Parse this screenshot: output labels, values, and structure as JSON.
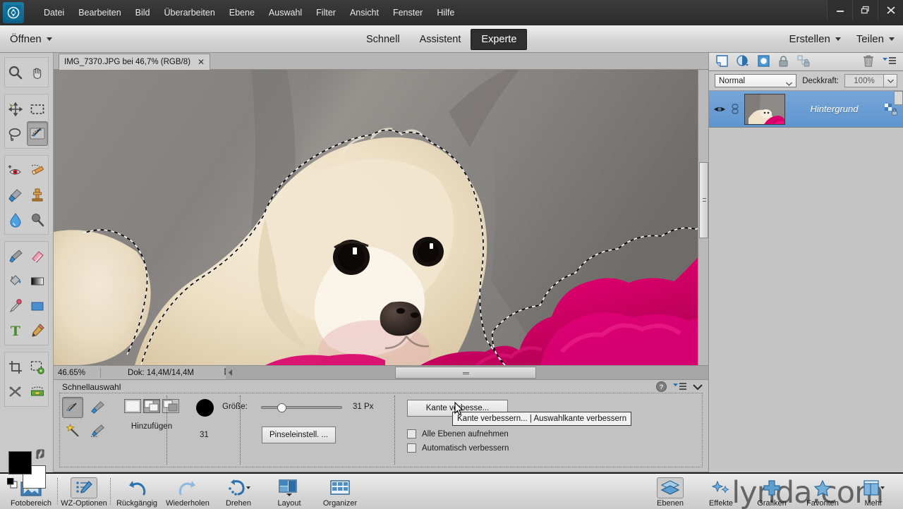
{
  "window": {
    "app_icon": "photoshop-elements-logo",
    "controls": {
      "minimize": "minimize-icon",
      "restore": "restore-icon",
      "close": "close-icon"
    }
  },
  "menubar": {
    "items": [
      {
        "label": "Datei"
      },
      {
        "label": "Bearbeiten"
      },
      {
        "label": "Bild"
      },
      {
        "label": "Überarbeiten"
      },
      {
        "label": "Ebene"
      },
      {
        "label": "Auswahl"
      },
      {
        "label": "Filter"
      },
      {
        "label": "Ansicht"
      },
      {
        "label": "Fenster"
      },
      {
        "label": "Hilfe"
      }
    ]
  },
  "modebar": {
    "open_label": "Öffnen",
    "modes": [
      {
        "label": "Schnell",
        "active": false
      },
      {
        "label": "Assistent",
        "active": false
      },
      {
        "label": "Experte",
        "active": true
      }
    ],
    "actions": [
      {
        "label": "Erstellen"
      },
      {
        "label": "Teilen"
      }
    ]
  },
  "toolbar": {
    "groups": [
      {
        "tools": [
          {
            "name": "zoom-tool"
          },
          {
            "name": "hand-tool"
          }
        ]
      },
      {
        "tools": [
          {
            "name": "move-tool"
          },
          {
            "name": "rectangular-marquee-tool"
          },
          {
            "name": "lasso-tool"
          },
          {
            "name": "quick-selection-tool",
            "selected": true
          }
        ]
      },
      {
        "tools": [
          {
            "name": "red-eye-removal-tool"
          },
          {
            "name": "spot-healing-brush-tool"
          },
          {
            "name": "smart-brush-tool"
          },
          {
            "name": "clone-stamp-tool"
          },
          {
            "name": "blur-tool"
          },
          {
            "name": "sponge-tool"
          }
        ]
      },
      {
        "tools": [
          {
            "name": "brush-tool"
          },
          {
            "name": "eraser-tool"
          },
          {
            "name": "paint-bucket-tool"
          },
          {
            "name": "gradient-tool"
          },
          {
            "name": "eyedropper-tool"
          },
          {
            "name": "shape-tool"
          },
          {
            "name": "type-tool"
          },
          {
            "name": "pencil-tool"
          }
        ]
      },
      {
        "tools": [
          {
            "name": "crop-tool"
          },
          {
            "name": "recompose-tool"
          },
          {
            "name": "content-aware-move-tool"
          },
          {
            "name": "straighten-tool"
          }
        ]
      }
    ],
    "colors": {
      "foreground": "#000000",
      "background": "#ffffff"
    }
  },
  "document": {
    "tab_title": "IMG_7370.JPG bei 46,7% (RGB/8)",
    "close_icon": "close-icon"
  },
  "statusbar": {
    "zoom": "46.65%",
    "doc_size": "Dok: 14,4M/14,4M"
  },
  "options": {
    "title": "Schnellauswahl",
    "header_icons": [
      "help-icon",
      "panel-menu-icon",
      "collapse-chevron-icon"
    ],
    "mode_tools": [
      {
        "name": "quick-selection-brush",
        "selected": true
      },
      {
        "name": "selection-brush"
      },
      {
        "name": "magic-wand"
      },
      {
        "name": "refine-selection-brush"
      }
    ],
    "add_label": "Hinzufügen",
    "add_modes": [
      {
        "name": "new-selection"
      },
      {
        "name": "add-to-selection",
        "selected": true
      },
      {
        "name": "subtract-from-selection"
      }
    ],
    "brush_preview_value": "31",
    "size_label": "Größe:",
    "size_value": "31 Px",
    "brush_settings_label": "Pinseleinstell. ...",
    "refine_edge_label": "Kante verbesse...",
    "checkboxes": [
      {
        "label": "Alle Ebenen aufnehmen",
        "checked": false
      },
      {
        "label": "Automatisch verbessern",
        "checked": false
      }
    ],
    "tooltip": "Kante verbessern... | Auswahlkante verbessern"
  },
  "layers_panel": {
    "toolbar_icons": [
      "new-layer-icon",
      "adjustment-layer-icon",
      "layer-mask-icon",
      "lock-icon",
      "link-layers-icon",
      "delete-layer-icon",
      "panel-menu-icon"
    ],
    "blend_mode": "Normal",
    "opacity_label": "Deckkraft:",
    "opacity_value": "100%",
    "layers": [
      {
        "name": "Hintergrund",
        "visible": true,
        "locked": true,
        "selected": true
      }
    ]
  },
  "taskbar": {
    "left_items": [
      {
        "label": "Fotobereich",
        "icon": "photo-bin-icon",
        "active": false
      },
      {
        "label": "WZ-Optionen",
        "icon": "tool-options-icon",
        "active": true
      },
      {
        "label": "Rückgängig",
        "icon": "undo-icon",
        "active": false
      },
      {
        "label": "Wiederholen",
        "icon": "redo-icon",
        "active": false
      },
      {
        "label": "Drehen",
        "icon": "rotate-icon",
        "active": false
      },
      {
        "label": "Layout",
        "icon": "layout-icon",
        "active": false
      },
      {
        "label": "Organizer",
        "icon": "organizer-icon",
        "active": false
      }
    ],
    "right_items": [
      {
        "label": "Ebenen",
        "icon": "layers-icon",
        "active": true
      },
      {
        "label": "Effekte",
        "icon": "effects-icon",
        "active": false
      },
      {
        "label": "Grafiken",
        "icon": "graphics-icon",
        "active": false
      },
      {
        "label": "Favoriten",
        "icon": "favorites-star-icon",
        "active": false
      },
      {
        "label": "Mehr",
        "icon": "more-icon",
        "active": false
      }
    ],
    "watermark": "lynda.com"
  },
  "colors": {
    "accent_blue": "#3d7ebd",
    "menubar_bg": "#2f2f2f",
    "panel_bg": "#c5c5c5",
    "selection_row": "#6a9cd4",
    "pink_fabric": "#e2007a"
  }
}
